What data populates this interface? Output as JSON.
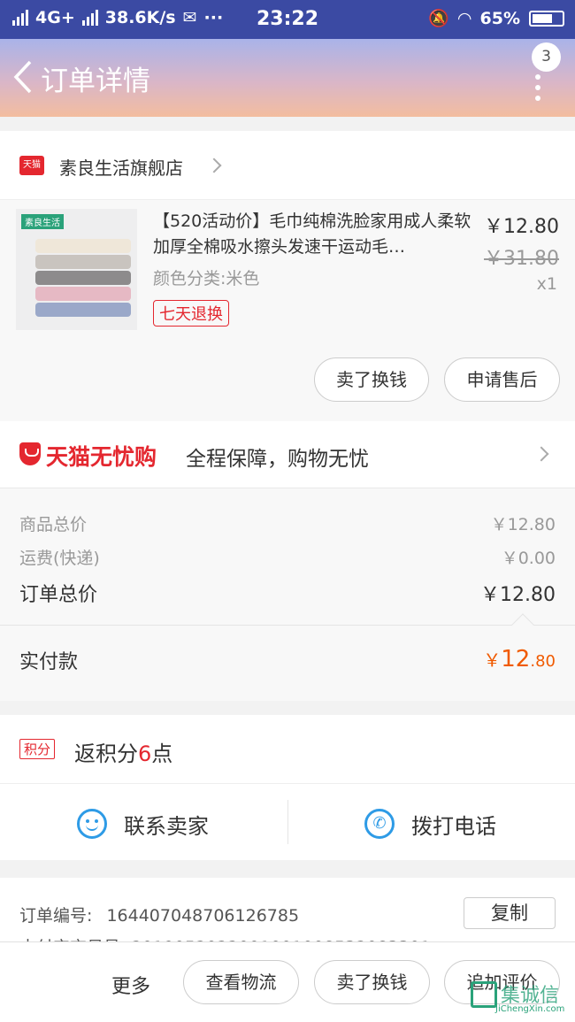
{
  "status_bar": {
    "network": "4G+",
    "speed": "38.6K/s",
    "more": "···",
    "time": "23:22",
    "battery": "65%"
  },
  "header": {
    "title": "订单详情",
    "badge_count": "3"
  },
  "shop": {
    "logo_text": "天猫",
    "name": "素良生活旗舰店"
  },
  "product": {
    "thumb_tag": "素良生活",
    "name": "【520活动价】毛巾纯棉洗脸家用成人柔软加厚全棉吸水擦头发速干运动毛…",
    "attr": "颜色分类:米色",
    "return_tag": "七天退换",
    "price": "￥12.80",
    "original_price": "￥31.80",
    "quantity": "x1",
    "buttons": [
      "卖了换钱",
      "申请售后"
    ]
  },
  "assurance": {
    "brand": "天猫无忧购",
    "text": "全程保障，购物无忧"
  },
  "summary": {
    "rows": [
      {
        "label": "商品总价",
        "value": "￥12.80"
      },
      {
        "label": "运费(快递)",
        "value": "￥0.00"
      },
      {
        "label": "订单总价",
        "value": "￥12.80"
      }
    ],
    "paid_label": "实付款",
    "paid_currency": "￥",
    "paid_int": "12",
    "paid_dec": ".80"
  },
  "points": {
    "tag": "积分",
    "prefix": "返积分",
    "value": "6",
    "suffix": "点"
  },
  "contact": {
    "seller": "联系卖家",
    "phone": "拨打电话"
  },
  "order_info": {
    "number_label": "订单编号:",
    "number_value": "164407048706126785",
    "copy_label": "复制",
    "partial_line": "支付宝交易号: 2019052022001001008532083301"
  },
  "bottom_bar": {
    "more": "更多",
    "buttons": [
      "查看物流",
      "卖了换钱",
      "追加评价"
    ]
  },
  "watermark": {
    "text": "集诚信",
    "sub": "JiChengXin.com"
  },
  "colors": {
    "accent": "#e4272f",
    "status_bar": "#3b4aa3",
    "paid": "#f05a00",
    "icon_blue": "#2e9be6"
  }
}
